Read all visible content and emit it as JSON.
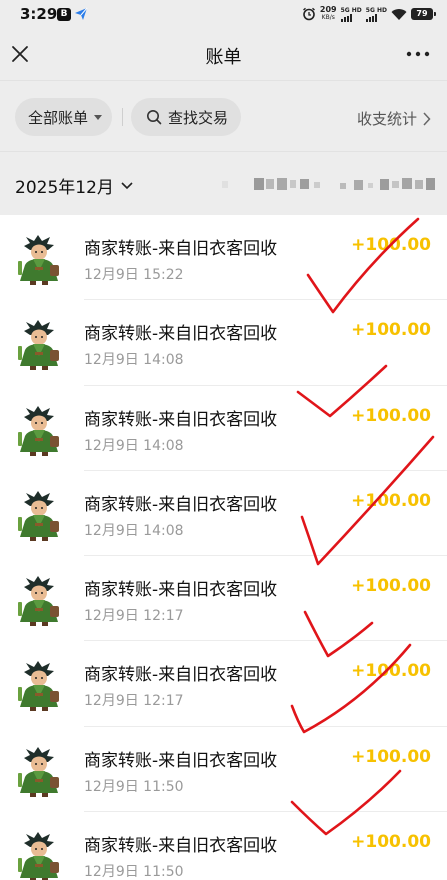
{
  "status_bar": {
    "time": "3:29",
    "net_speed_value": "209",
    "net_speed_unit": "KB/s",
    "signal_1_label": "5G HD",
    "signal_2_label": "5G HD",
    "battery": "79",
    "icons": [
      "notification-app-icon",
      "send-app-icon",
      "alarm-icon",
      "wifi-icon",
      "battery-icon"
    ]
  },
  "header": {
    "title": "账单",
    "close_icon": "close-icon",
    "more_icon": "more-icon"
  },
  "filters": {
    "all_bills": "全部账单",
    "search": "查找交易",
    "stats": "收支统计"
  },
  "month": {
    "label": "2025年12月"
  },
  "transactions": [
    {
      "title": "商家转账-来自旧衣客回收",
      "time": "12月9日 15:22",
      "amount": "+100.00"
    },
    {
      "title": "商家转账-来自旧衣客回收",
      "time": "12月9日 14:08",
      "amount": "+100.00"
    },
    {
      "title": "商家转账-来自旧衣客回收",
      "time": "12月9日 14:08",
      "amount": "+100.00"
    },
    {
      "title": "商家转账-来自旧衣客回收",
      "time": "12月9日 14:08",
      "amount": "+100.00"
    },
    {
      "title": "商家转账-来自旧衣客回收",
      "time": "12月9日 12:17",
      "amount": "+100.00"
    },
    {
      "title": "商家转账-来自旧衣客回收",
      "time": "12月9日 12:17",
      "amount": "+100.00"
    },
    {
      "title": "商家转账-来自旧衣客回收",
      "time": "12月9日 11:50",
      "amount": "+100.00"
    },
    {
      "title": "商家转账-来自旧衣客回收",
      "time": "12月9日 11:50",
      "amount": "+100.00"
    }
  ],
  "colors": {
    "amount": "#f7c100",
    "annotation": "#e0151a",
    "header_bg": "#ededed"
  }
}
